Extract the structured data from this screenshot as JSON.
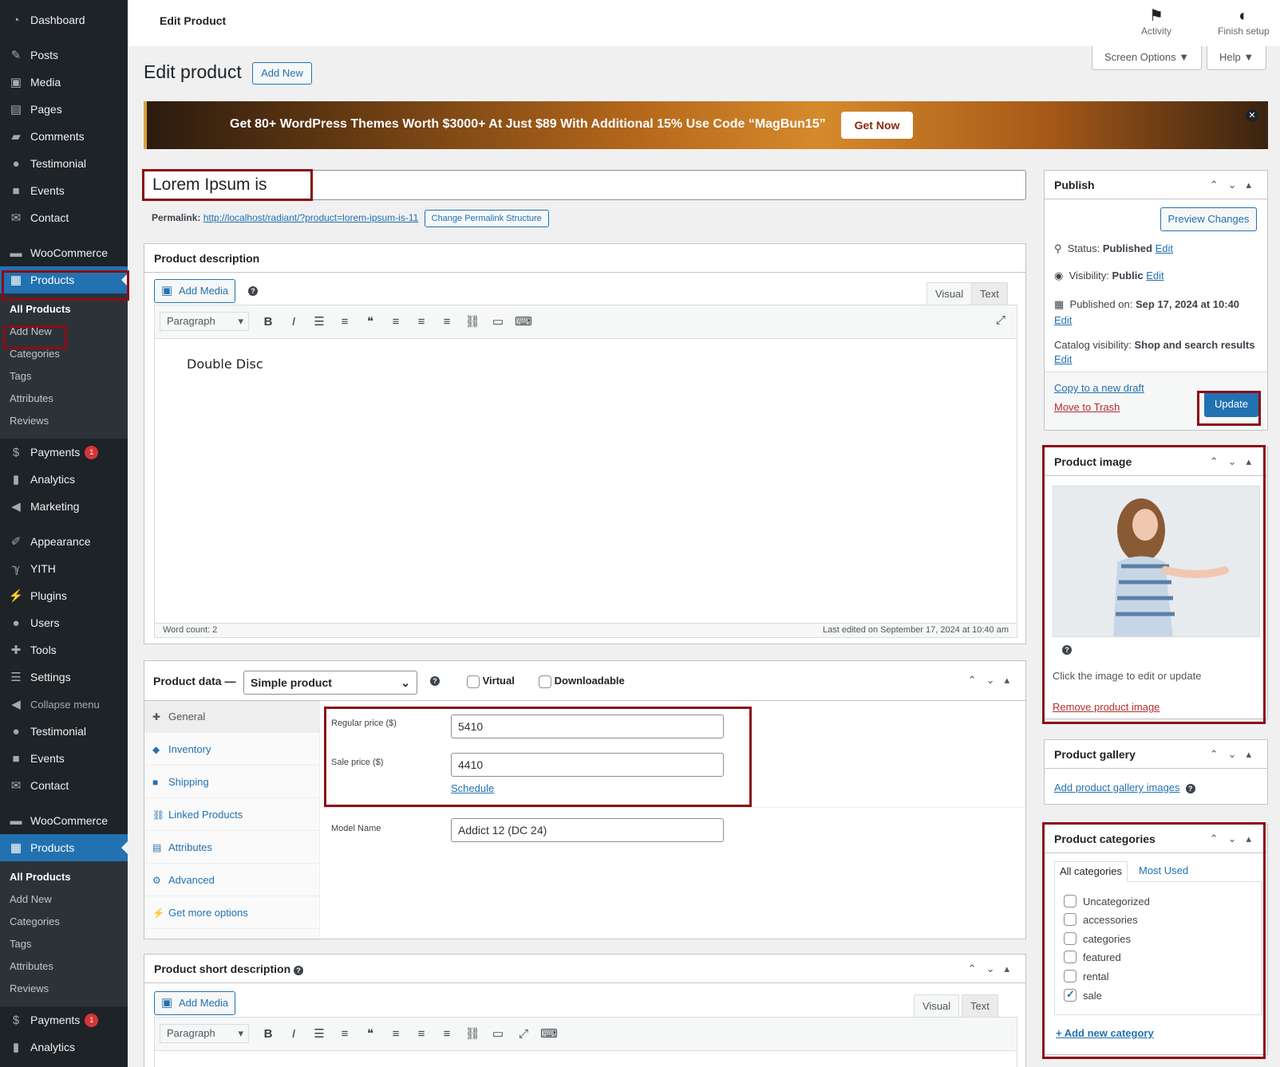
{
  "sidebar": {
    "top_items": [
      {
        "label": "Dashboard",
        "icon": "dashboard-icon"
      },
      {
        "label": "Posts",
        "icon": "pin-icon"
      },
      {
        "label": "Media",
        "icon": "media-icon"
      },
      {
        "label": "Pages",
        "icon": "pages-icon"
      },
      {
        "label": "Comments",
        "icon": "comments-icon"
      },
      {
        "label": "Testimonial",
        "icon": "person-icon"
      },
      {
        "label": "Events",
        "icon": "camera-icon"
      },
      {
        "label": "Contact",
        "icon": "mail-icon"
      },
      {
        "label": "WooCommerce",
        "icon": "woo-icon"
      },
      {
        "label": "Products",
        "icon": "archive-icon"
      }
    ],
    "submenu": [
      "All Products",
      "Add New",
      "Categories",
      "Tags",
      "Attributes",
      "Reviews"
    ],
    "mid_items": [
      {
        "label": "Payments",
        "badge": "1"
      },
      {
        "label": "Analytics"
      },
      {
        "label": "Marketing"
      },
      {
        "label": "Appearance"
      },
      {
        "label": "YITH"
      },
      {
        "label": "Plugins"
      },
      {
        "label": "Users"
      },
      {
        "label": "Tools"
      },
      {
        "label": "Settings"
      },
      {
        "label": "Collapse menu"
      },
      {
        "label": "Testimonial"
      },
      {
        "label": "Events"
      },
      {
        "label": "Contact"
      },
      {
        "label": "WooCommerce"
      },
      {
        "label": "Products"
      }
    ],
    "submenu2": [
      "All Products",
      "Add New",
      "Categories",
      "Tags",
      "Attributes",
      "Reviews"
    ],
    "bottom_items": [
      {
        "label": "Payments",
        "badge": "1"
      },
      {
        "label": "Analytics"
      }
    ]
  },
  "topbar": {
    "title": "Edit Product",
    "activity": "Activity",
    "finish_setup": "Finish setup",
    "screen_options": "Screen Options ▼",
    "help": "Help ▼"
  },
  "heading": {
    "title": "Edit product",
    "add_new": "Add New"
  },
  "banner": {
    "text": "Get 80+ WordPress Themes Worth $3000+ At Just $89 With Additional 15% Use Code “MagBun15”",
    "cta": "Get Now",
    "close": "✕"
  },
  "post": {
    "title": "Lorem Ipsum is",
    "permalink_label": "Permalink:",
    "permalink_url": "http://localhost/radiant/?product=lorem-ipsum-is-11",
    "change_permalink": "Change Permalink Structure"
  },
  "description": {
    "title": "Product description",
    "add_media": "Add Media",
    "tab_visual": "Visual",
    "tab_text": "Text",
    "format": "Paragraph",
    "content": "Double Disc",
    "word_count": "Word count: 2",
    "last_edited": "Last edited on September 17, 2024 at 10:40 am"
  },
  "product_data": {
    "title": "Product data —",
    "type": "Simple product",
    "virtual": "Virtual",
    "downloadable": "Downloadable",
    "tabs": [
      "General",
      "Inventory",
      "Shipping",
      "Linked Products",
      "Attributes",
      "Advanced",
      "Get more options"
    ],
    "regular_price_label": "Regular price ($)",
    "regular_price": "5410",
    "sale_price_label": "Sale price ($)",
    "sale_price": "4410",
    "schedule": "Schedule",
    "model_label": "Model Name",
    "model_value": "Addict 12 (DC 24)"
  },
  "short_description": {
    "title": "Product short description",
    "add_media": "Add Media",
    "tab_visual": "Visual",
    "tab_text": "Text",
    "format": "Paragraph"
  },
  "publish": {
    "title": "Publish",
    "preview": "Preview Changes",
    "status_label": "Status:",
    "status_value": "Published",
    "visibility_label": "Visibility:",
    "visibility_value": "Public",
    "published_label": "Published on:",
    "published_value": "Sep 17, 2024 at 10:40",
    "catalog_label": "Catalog visibility:",
    "catalog_value": "Shop and search results",
    "edit": "Edit",
    "copy_draft": "Copy to a new draft",
    "trash": "Move to Trash",
    "update": "Update"
  },
  "product_image": {
    "title": "Product image",
    "hint": "Click the image to edit or update",
    "remove": "Remove product image"
  },
  "gallery": {
    "title": "Product gallery",
    "add": "Add product gallery images"
  },
  "categories": {
    "title": "Product categories",
    "tab_all": "All categories",
    "tab_used": "Most Used",
    "items": [
      {
        "label": "Uncategorized",
        "checked": false
      },
      {
        "label": "accessories",
        "checked": false
      },
      {
        "label": "categories",
        "checked": false
      },
      {
        "label": "featured",
        "checked": false
      },
      {
        "label": "rental",
        "checked": false
      },
      {
        "label": "sale",
        "checked": true
      }
    ],
    "add_new": "+ Add new category"
  },
  "colors": {
    "admin_dark": "#1d2327",
    "accent": "#2271b1",
    "highlight": "#8b0c17"
  }
}
